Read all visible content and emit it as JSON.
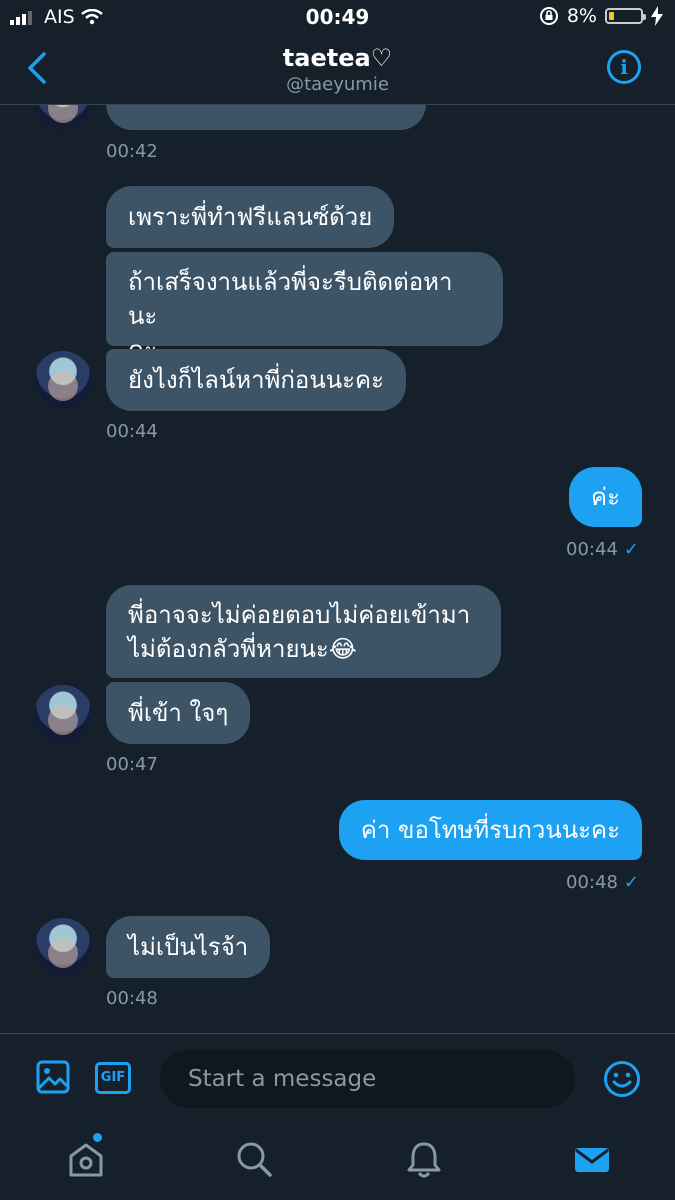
{
  "status": {
    "carrier": "AIS",
    "time": "00:49",
    "battery": "8%"
  },
  "header": {
    "name": "taetea♡",
    "handle": "@taeyumie"
  },
  "messages": [
    {
      "text": "",
      "time": "00:42"
    },
    {
      "text": "เพราะพี่ทำฟรีแลนซ์ด้วย"
    },
    {
      "text": "ถ้าเสร็จงานแล้วพี่จะรีบติดต่อหานะ",
      "text2": "คะ"
    },
    {
      "text": "ยังไงก็ไลน์หาพี่ก่อนนะคะ",
      "time": "00:44"
    },
    {
      "text": "ค่ะ",
      "time": "00:44"
    },
    {
      "text": "พี่อาจจะไม่ค่อยตอบไม่ค่อยเข้ามา",
      "text2": "ไม่ต้องกลัวพี่หายนะ😂"
    },
    {
      "text": "พี่เข้า ใจๆ",
      "time": "00:47"
    },
    {
      "text": "ค่า ขอโทษที่รบกวนนะคะ",
      "time": "00:48"
    },
    {
      "text": "ไม่เป็นไรจ้า",
      "time": "00:48"
    }
  ],
  "composer": {
    "placeholder": "Start a message"
  },
  "colors": {
    "accent": "#1da1f2",
    "background": "#15202b",
    "incoming_bubble": "#3d5466"
  },
  "icons": [
    "back-chevron-icon",
    "info-icon",
    "image-icon",
    "gif-icon",
    "emoji-icon",
    "home-icon",
    "search-icon",
    "bell-icon",
    "mail-icon"
  ]
}
